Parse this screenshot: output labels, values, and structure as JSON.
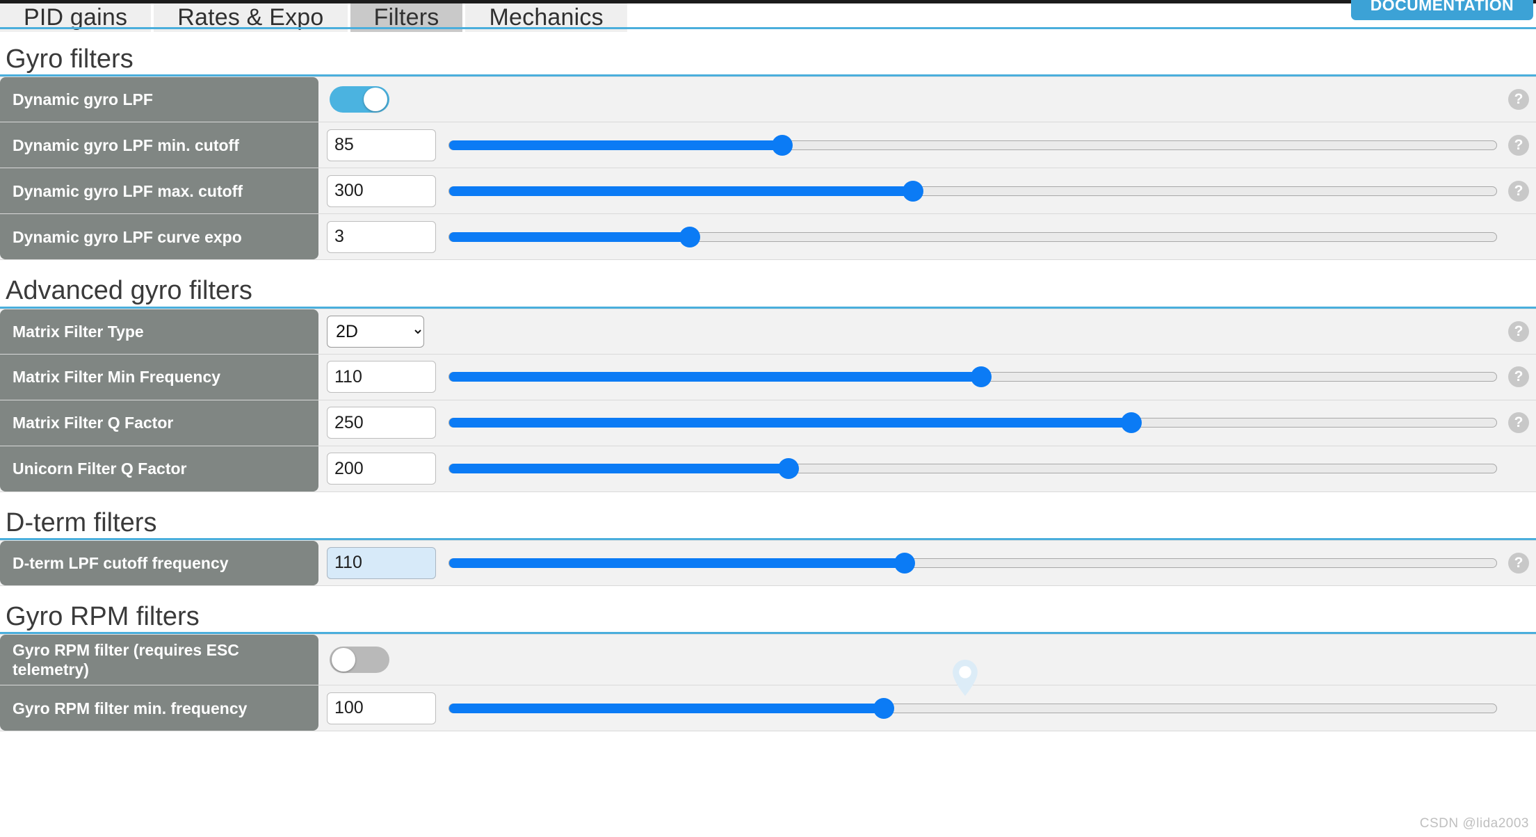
{
  "topbar": {
    "tabs": [
      {
        "label": "PID gains",
        "active": false
      },
      {
        "label": "Rates & Expo",
        "active": false
      },
      {
        "label": "Filters",
        "active": true
      },
      {
        "label": "Mechanics",
        "active": false
      }
    ],
    "documentation_label": "DOCUMENTATION"
  },
  "colors": {
    "accent_blue": "#4aaedc",
    "slider_blue": "#0b7bf5",
    "toggle_on": "#4bb3e0",
    "toggle_off": "#b9b9b9",
    "label_gray": "#808683",
    "row_bg": "#f2f2f2",
    "focused_input": "#d7eaf9",
    "help_icon": "#c8c8c8"
  },
  "help_icon_glyph": "?",
  "sections": [
    {
      "title": "Gyro filters",
      "rows": [
        {
          "label": "Dynamic gyro LPF",
          "control": "toggle",
          "toggle_state": "on",
          "help": true
        },
        {
          "label": "Dynamic gyro LPF min. cutoff",
          "control": "slider",
          "value": "85",
          "slider_percent": 31.8,
          "help": true
        },
        {
          "label": "Dynamic gyro LPF max. cutoff",
          "control": "slider",
          "value": "300",
          "slider_percent": 44.3,
          "help": true
        },
        {
          "label": "Dynamic gyro LPF curve expo",
          "control": "slider",
          "value": "3",
          "slider_percent": 23.0,
          "help": false
        }
      ]
    },
    {
      "title": "Advanced gyro filters",
      "rows": [
        {
          "label": "Matrix Filter Type",
          "control": "select",
          "value": "2D",
          "options": [
            "2D"
          ],
          "help": true
        },
        {
          "label": "Matrix Filter Min Frequency",
          "control": "slider",
          "value": "110",
          "slider_percent": 50.8,
          "help": true
        },
        {
          "label": "Matrix Filter Q Factor",
          "control": "slider",
          "value": "250",
          "slider_percent": 65.1,
          "help": true
        },
        {
          "label": "Unicorn Filter Q Factor",
          "control": "slider",
          "value": "200",
          "slider_percent": 32.4,
          "help": false
        }
      ]
    },
    {
      "title": "D-term filters",
      "rows": [
        {
          "label": "D-term LPF cutoff frequency",
          "control": "slider",
          "value": "110",
          "slider_percent": 43.5,
          "focused": true,
          "help": true
        }
      ]
    },
    {
      "title": "Gyro RPM filters",
      "rows": [
        {
          "label": "Gyro RPM filter (requires ESC telemetry)",
          "control": "toggle",
          "toggle_state": "off",
          "help": false
        },
        {
          "label": "Gyro RPM filter min. frequency",
          "control": "slider",
          "value": "100",
          "slider_percent": 41.5,
          "help": false
        }
      ]
    }
  ],
  "watermark": "CSDN @lida2003"
}
